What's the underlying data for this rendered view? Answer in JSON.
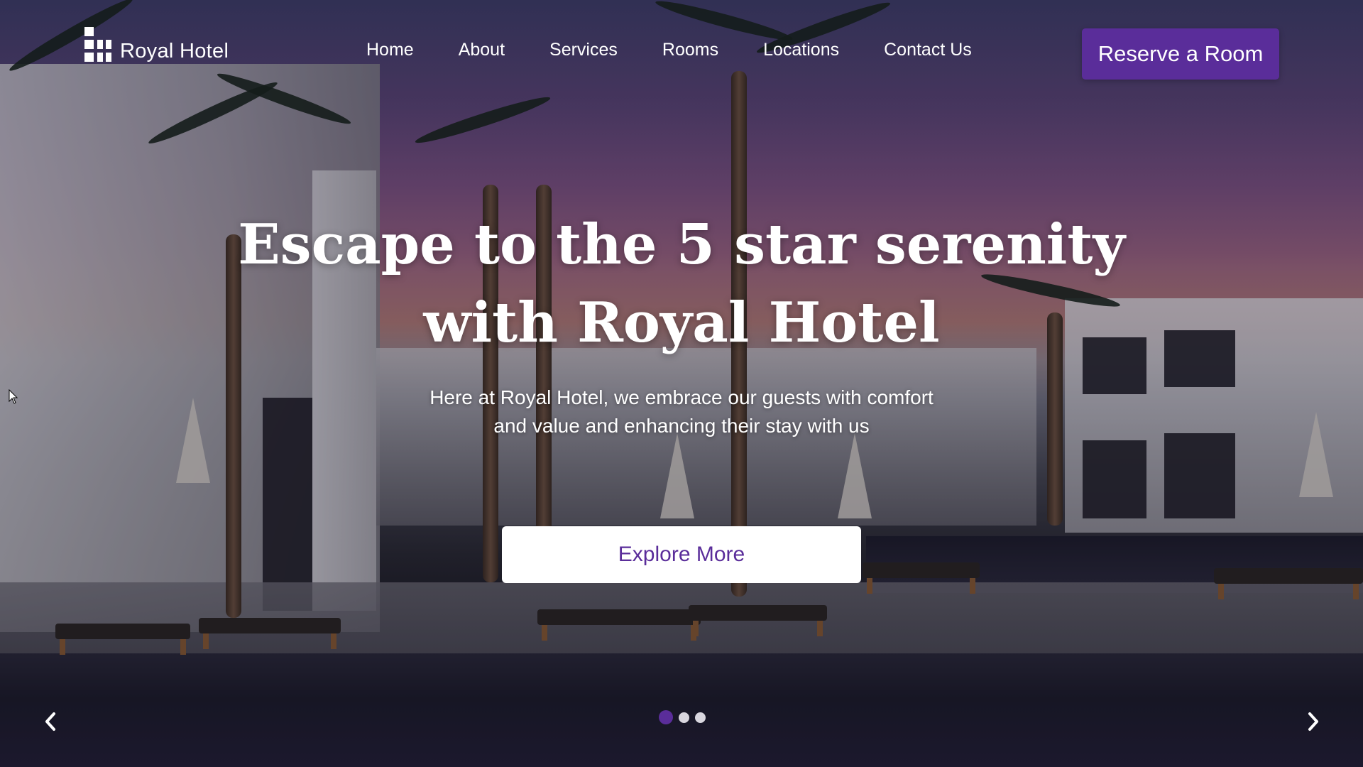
{
  "brand": {
    "name": "Royal Hotel",
    "icon": "building-blocks-icon"
  },
  "nav": {
    "items": [
      {
        "label": "Home"
      },
      {
        "label": "About"
      },
      {
        "label": "Services"
      },
      {
        "label": "Rooms"
      },
      {
        "label": "Locations"
      },
      {
        "label": "Contact Us"
      }
    ],
    "cta_label": "Reserve a Room"
  },
  "hero": {
    "headline_line1": "Escape to the 5 star serenity",
    "headline_line2": "with Royal Hotel",
    "subtext_line1": "Here at Royal Hotel, we embrace our guests with comfort",
    "subtext_line2": "and value and enhancing their stay with us",
    "cta_label": "Explore More"
  },
  "carousel": {
    "prev_icon": "chevron-left-icon",
    "next_icon": "chevron-right-icon",
    "slide_count": 3,
    "active_index": 0
  },
  "colors": {
    "accent": "#5a2d9a",
    "button_text": "#5a2d9a",
    "text": "#ffffff"
  }
}
